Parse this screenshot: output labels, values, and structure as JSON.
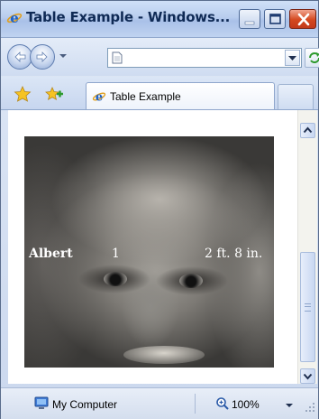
{
  "window": {
    "title": "Table Example - Windows...",
    "minimize_icon": "minimize-icon",
    "maximize_icon": "maximize-icon",
    "close_icon": "close-icon"
  },
  "navigation": {
    "back_icon": "back-arrow-icon",
    "forward_icon": "forward-arrow-icon",
    "recent_pages_icon": "chevron-down-icon",
    "address_value": "",
    "address_icon": "page-icon",
    "refresh_icon": "refresh-icon"
  },
  "tabs": {
    "favorites_icon": "star-icon",
    "add_favorite_icon": "add-favorite-icon",
    "active_tab_label": "Table Example",
    "active_tab_icon": "ie-icon"
  },
  "page": {
    "table": {
      "background": "einstein-photo",
      "rows": [
        {
          "name": "Albert",
          "number": "1",
          "height": "2 ft. 8 in."
        }
      ]
    }
  },
  "status": {
    "zone_label": "My Computer",
    "zone_icon": "computer-icon",
    "zoom_label": "100%",
    "zoom_icon": "zoom-icon"
  },
  "colors": {
    "title_text": "#0f2a55",
    "close_button": "#d4481f",
    "cell_text": "#ffffff"
  }
}
